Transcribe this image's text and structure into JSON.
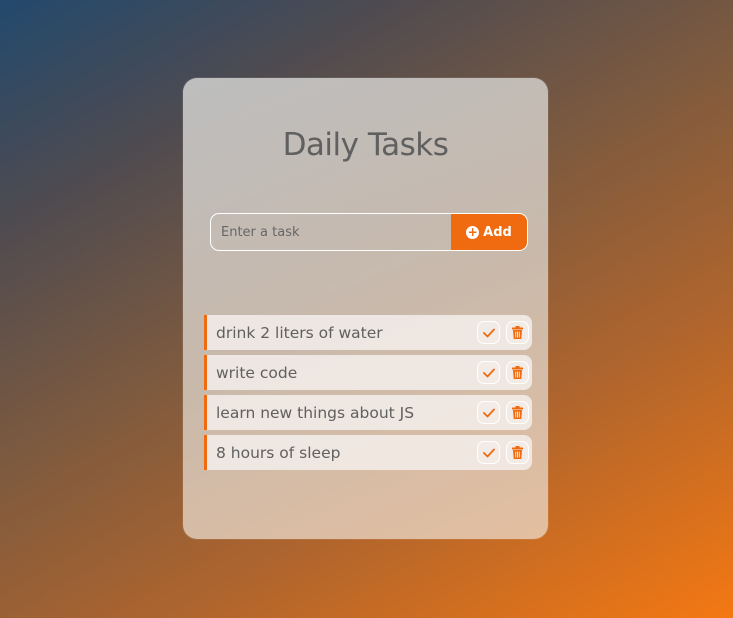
{
  "app": {
    "title": "Daily Tasks"
  },
  "form": {
    "placeholder": "Enter a task",
    "value": "",
    "add_label": "Add"
  },
  "tasks": [
    {
      "text": "drink 2 liters of water"
    },
    {
      "text": "write code"
    },
    {
      "text": "learn new things about JS"
    },
    {
      "text": "8 hours of sleep"
    }
  ],
  "colors": {
    "accent": "#f06a0f",
    "title": "#606060"
  },
  "icons": {
    "add": "plus-circle-icon",
    "complete": "check-icon",
    "delete": "trash-icon"
  }
}
